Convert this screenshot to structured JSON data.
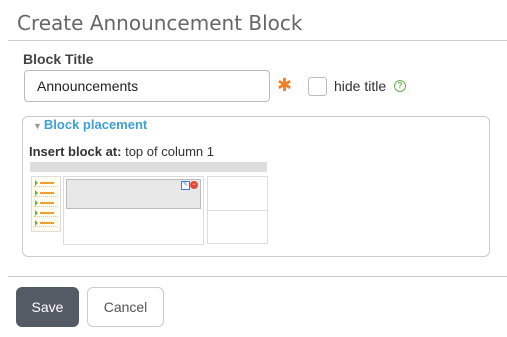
{
  "header": {
    "title": "Create Announcement Block"
  },
  "form": {
    "block_title_label": "Block Title",
    "block_title_value": "Announcements",
    "required_mark": "✱",
    "hide_title_label": "hide title",
    "help_glyph": "?"
  },
  "placement": {
    "legend": "Block placement",
    "legend_arrow": "▼",
    "insert_label": "Insert block at:",
    "insert_value": "top of column 1"
  },
  "actions": {
    "save_label": "Save",
    "cancel_label": "Cancel"
  },
  "colors": {
    "accent": "#3ea0d4",
    "required": "#f07e26",
    "primary_button": "#545b64",
    "help": "#6ab04c"
  }
}
